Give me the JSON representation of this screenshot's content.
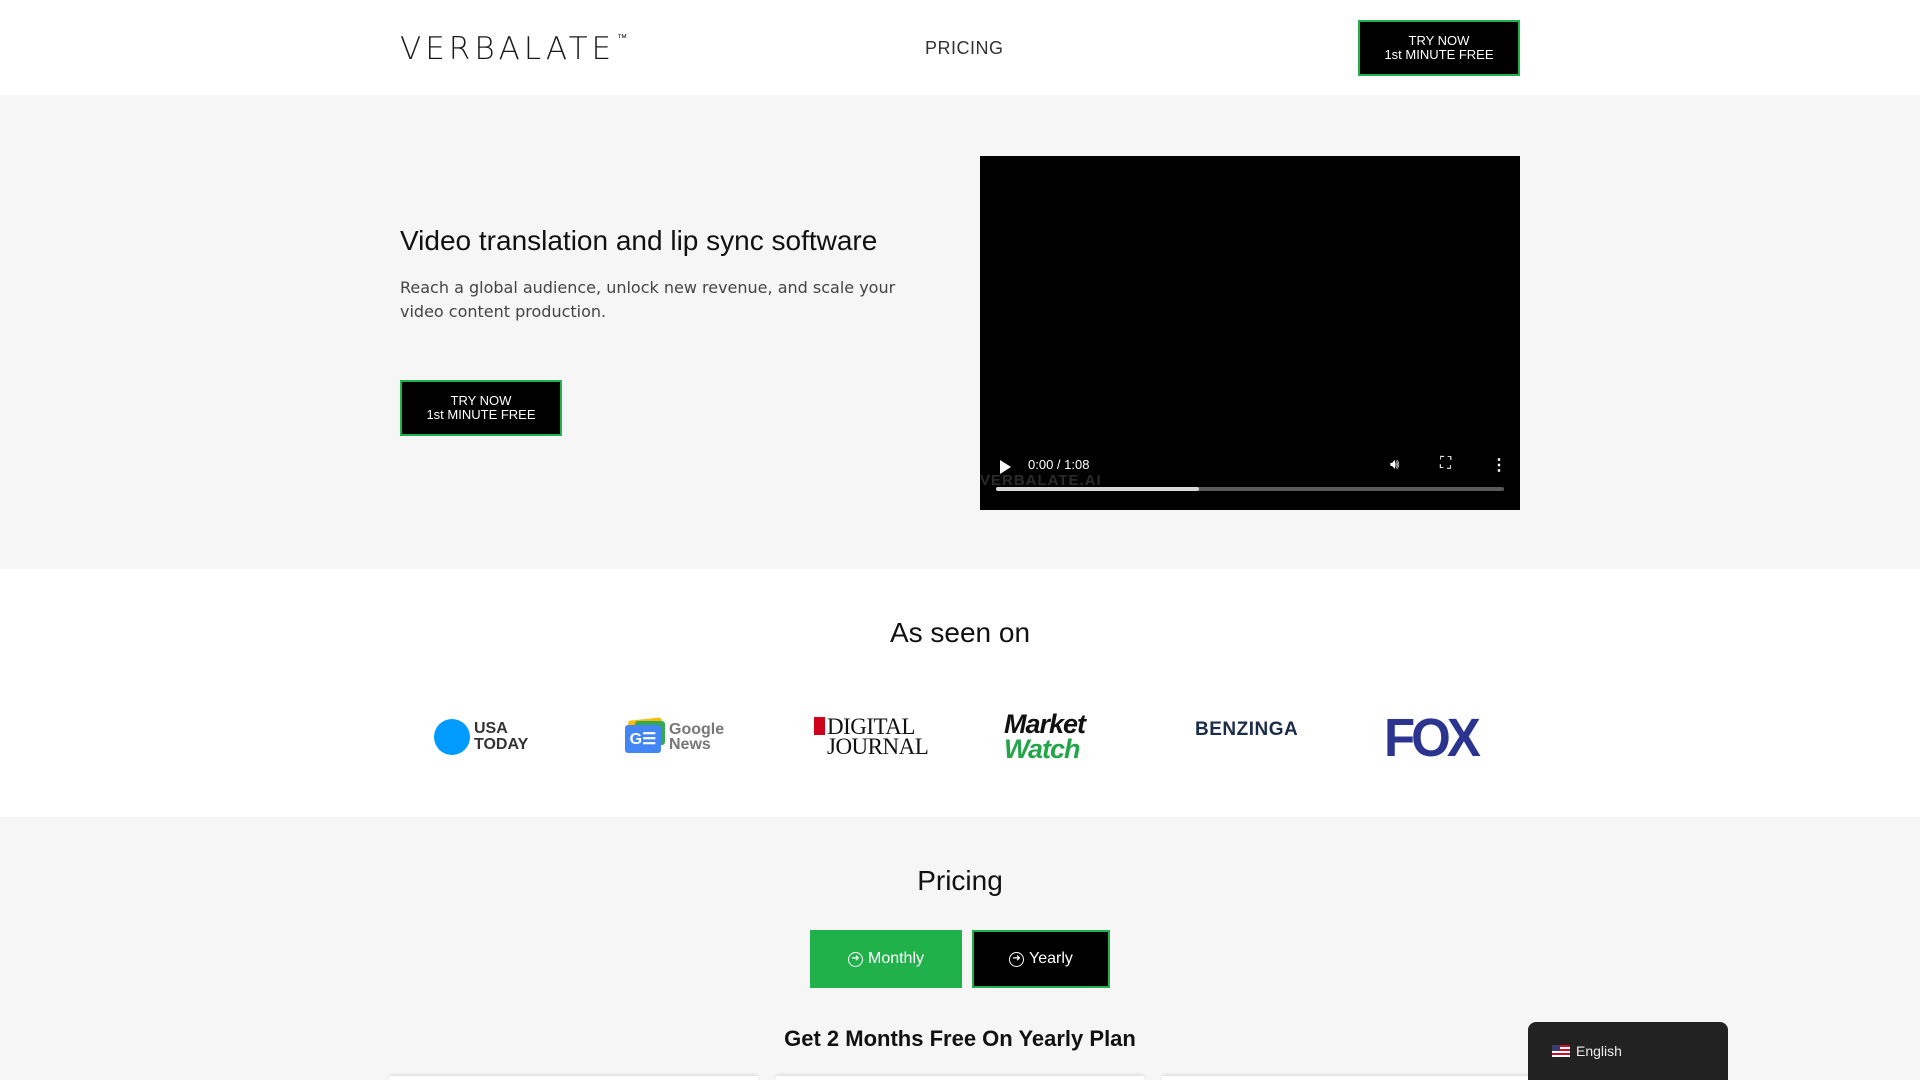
{
  "header": {
    "logo": "VERBALATE",
    "logo_tm": "™",
    "nav_pricing": "PRICING",
    "cta_line1": "TRY NOW",
    "cta_line2": "1st MINUTE FREE"
  },
  "hero": {
    "title": "Video translation and lip sync software",
    "subtitle": "Reach a global audience, unlock new revenue, and scale your video content production.",
    "cta_line1": "TRY NOW",
    "cta_line2": "1st MINUTE FREE",
    "video": {
      "time": "0:00 / 1:08",
      "watermark": "VERBALATE.AI",
      "progress_buffered_percent": 40
    }
  },
  "seen_on": {
    "title": "As seen on",
    "logos": {
      "usa_today": [
        "USA",
        "TODAY"
      ],
      "google_news": [
        "Google",
        "News"
      ],
      "google_news_mark": "G☰",
      "digital_journal": [
        "DIGITAL",
        "JOURNAL"
      ],
      "marketwatch": [
        "Market",
        "Watch"
      ],
      "benzinga": "BENZINGA",
      "fox": "FOX"
    }
  },
  "pricing": {
    "title": "Pricing",
    "monthly": "Monthly",
    "yearly": "Yearly",
    "promo": "Get 2 Months Free On Yearly Plan"
  },
  "language": {
    "current": "English"
  },
  "colors": {
    "accent_green": "#21b14b",
    "black": "#000000",
    "background": "#f6f6f6"
  }
}
